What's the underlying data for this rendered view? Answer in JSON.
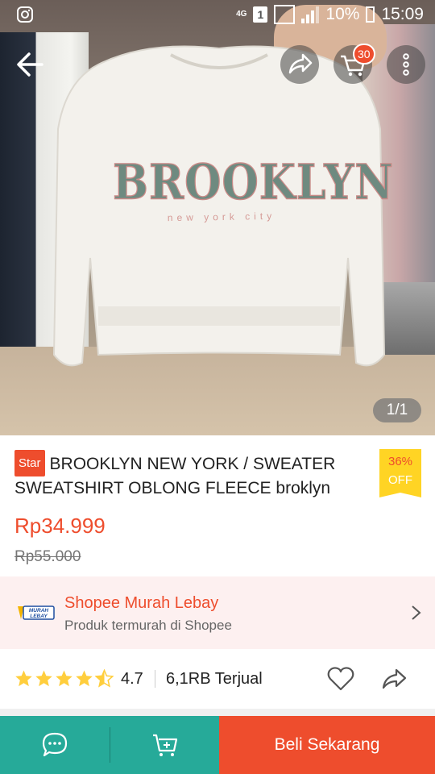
{
  "status_bar": {
    "network": "4G",
    "sim": "1",
    "battery": "10%",
    "time": "15:09"
  },
  "header": {
    "icons": [
      "back-arrow-icon",
      "share-icon",
      "cart-icon",
      "more-vert-icon"
    ],
    "cart_count": "30"
  },
  "gallery": {
    "counter": "1/1",
    "print_main": "BROOKLYN",
    "print_sub": "new york city"
  },
  "product": {
    "badge": "Star",
    "title": "BROOKLYN NEW YORK / SWEATER SWEATSHIRT OBLONG FLEECE broklyn",
    "discount_percent": "36%",
    "discount_label": "OFF",
    "price": "Rp34.999",
    "original_price": "Rp55.000"
  },
  "promo": {
    "logo_text": "MURAH LEBAY",
    "title": "Shopee Murah Lebay",
    "subtitle": "Produk termurah di Shopee"
  },
  "rating": {
    "stars": 4.5,
    "value": "4.7",
    "sold": "6,1RB Terjual"
  },
  "bottom_bar": {
    "buy_label": "Beli Sekarang"
  },
  "colors": {
    "brand": "#ee4d2d",
    "teal": "#26aa99",
    "discount_bg": "#ffd424",
    "star": "#ffce3d"
  }
}
